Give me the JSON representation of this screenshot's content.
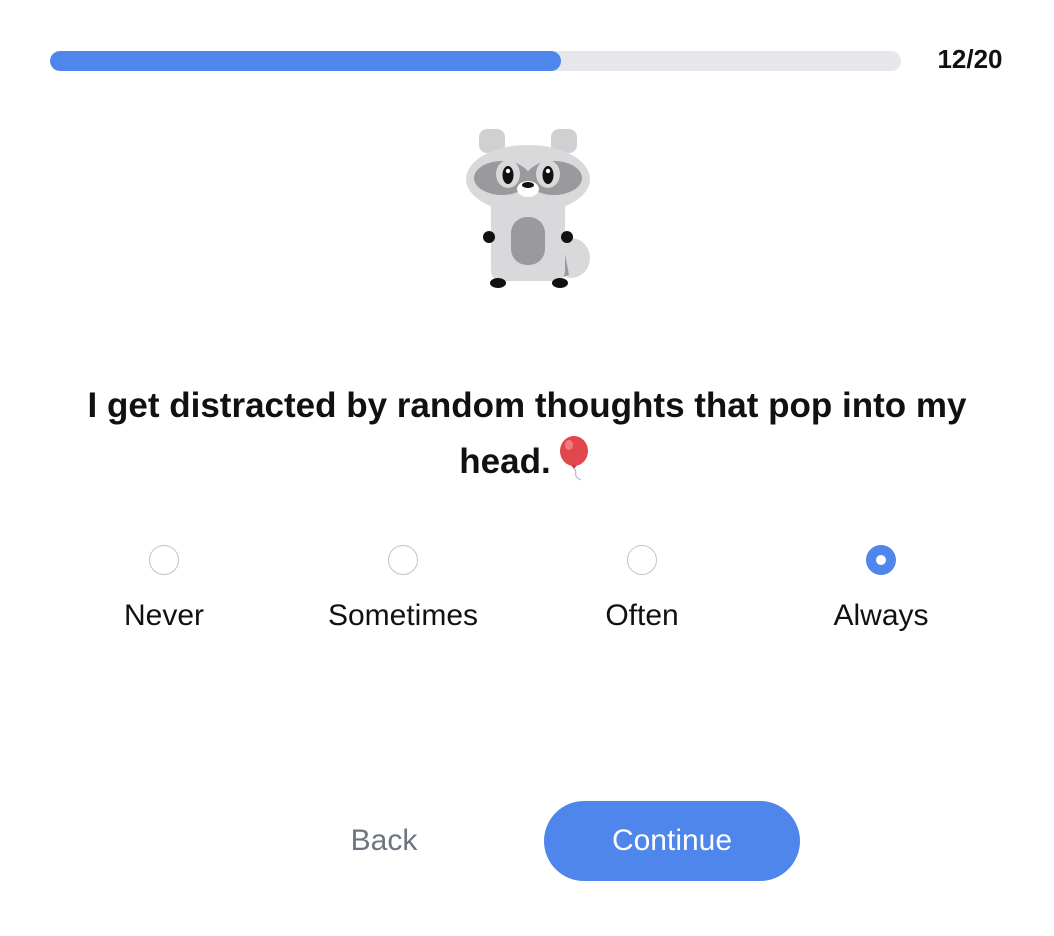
{
  "progress": {
    "current": 12,
    "total": 20,
    "label": "12/20",
    "fraction": 0.6,
    "colors": {
      "fill": "#4f86ec",
      "track": "#e6e7eb"
    }
  },
  "mascot": {
    "icon": "raccoon-icon"
  },
  "question": {
    "text": "I get distracted by random thoughts that pop into my head.",
    "emoji_icon": "balloon-icon"
  },
  "options": [
    {
      "label": "Never",
      "selected": false
    },
    {
      "label": "Sometimes",
      "selected": false
    },
    {
      "label": "Often",
      "selected": false
    },
    {
      "label": "Always",
      "selected": true
    }
  ],
  "buttons": {
    "back_label": "Back",
    "continue_label": "Continue"
  },
  "colors": {
    "accent": "#4f86ec",
    "text": "#111111",
    "muted": "#6e7480"
  }
}
